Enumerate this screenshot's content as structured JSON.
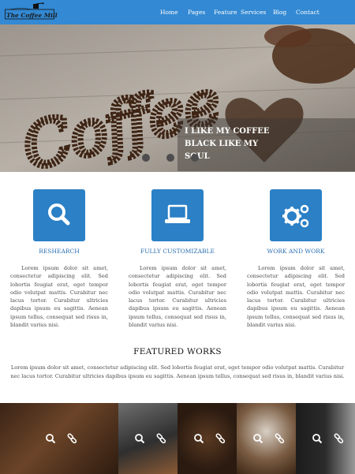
{
  "brand": {
    "logo_text": "The Coffee Mill"
  },
  "nav": {
    "items": [
      {
        "label": "Home"
      },
      {
        "label": "Pages"
      },
      {
        "label": "Feature"
      },
      {
        "label": "Services"
      },
      {
        "label": "Blog"
      },
      {
        "label": "Contact"
      }
    ]
  },
  "hero": {
    "banner_word": "Coffee",
    "quote": "I LIKE MY COFFEE BLACK LIKE MY SOUL",
    "slide_count": 3,
    "active_slide": 2
  },
  "features": [
    {
      "title": "RESHEARCH",
      "icon": "search-icon",
      "body": "Lorem ipsum dolor sit amet, consectetur adipiscing elit. Sed lobortis feugiat erat, eget tempor odio volutpat mattis. Curabitur nec lacus tortor. Curabitur ultricies dapibus ipsum eu sagittis. Aenean ipsum tellus, consequat sed risus in, blandit varius nisi."
    },
    {
      "title": "FULLY CUSTOMIZABLE",
      "icon": "laptop-icon",
      "body": "Lorem ipsum dolor sit amet, consectetur adipiscing elit. Sed lobortis feugiat erat, eget tempor odio volutpat mattis. Curabitur nec lacus tortor. Curabitur ultricies dapibus ipsum eu sagittis. Aenean ipsum tellus, consequat sed risus in, blandit varius nisi."
    },
    {
      "title": "WORK AND WORK",
      "icon": "gears-icon",
      "body": "Lorem ipsum dolor sit amet, consectetur adipiscing elit. Sed lobortis feugiat erat, eget tempor odio volutpat mattis. Curabitur nec lacus tortor. Curabitur ultricies dapibus ipsum eu sagittis. Aenean ipsum tellus, consequat sed risus in, blandit varius nisi."
    }
  ],
  "featured_works": {
    "title": "FEATURED WORKS",
    "description": "Lorem ipsum dolor sit amet, consectetur adipiscing elit. Sed lobortis feugiat erat, eget tempor odio volutpat mattis. Curabitur nec lacus tortor. Curabitur ultricies dapibus ipsum eu sagittis. Aenean ipsum tellus, consequat sed risus in, blandit varius nisi."
  },
  "gallery": {
    "items": [
      {
        "icons": [
          "search-icon",
          "link-icon"
        ]
      },
      {
        "icons": [
          "search-icon",
          "link-icon"
        ]
      },
      {
        "icons": [
          "search-icon",
          "link-icon"
        ]
      },
      {
        "icons": [
          "search-icon",
          "link-icon"
        ]
      },
      {
        "icons": [
          "search-icon",
          "link-icon"
        ]
      }
    ]
  },
  "colors": {
    "primary": "#3389d3",
    "feature_box": "#2b80c6",
    "feature_title": "#2b6fb0",
    "text": "#4a4a4a"
  }
}
